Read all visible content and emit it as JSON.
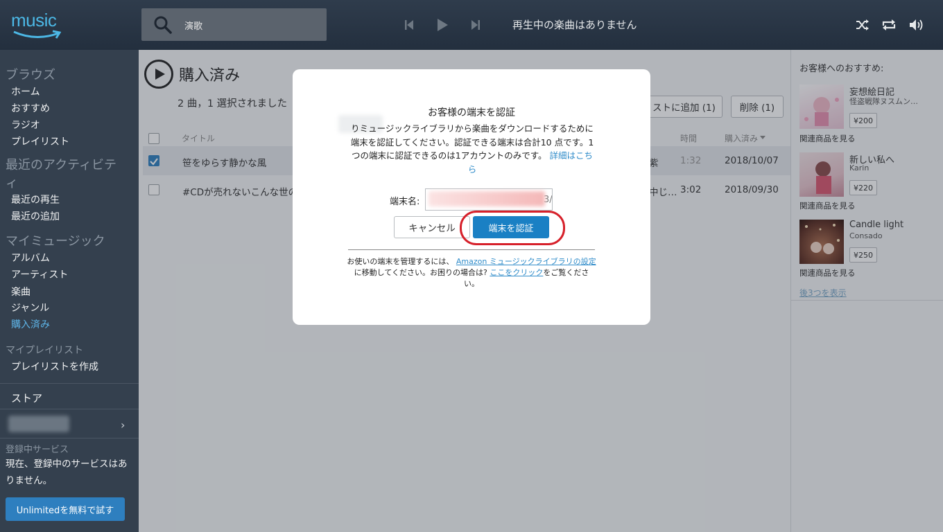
{
  "app": {
    "logo_text": "music",
    "brand_color": "#4cb8e6"
  },
  "search": {
    "value": "演歌"
  },
  "player": {
    "now_playing": "再生中の楽曲はありません"
  },
  "sidebar": {
    "browse_head": "ブラウズ",
    "browse_items": [
      "ホーム",
      "おすすめ",
      "ラジオ",
      "プレイリスト"
    ],
    "recent_head": "最近のアクティビティ",
    "recent_items": [
      "最近の再生",
      "最近の追加"
    ],
    "mymusic_head": "マイミュージック",
    "mymusic_items": [
      "アルバム",
      "アーティスト",
      "楽曲",
      "ジャンル",
      "購入済み"
    ],
    "playlists_head": "マイプレイリスト",
    "create_playlist": "プレイリストを作成",
    "store": "ストア",
    "services_head": "登録中サービス",
    "services_text": "現在、登録中のサービスはありません。",
    "unlimited_button": "Unlimitedを無料で試す"
  },
  "main": {
    "title": "購入済み",
    "selection": "2 曲，1 選択されました",
    "add_button": "ストに追加 (1)",
    "delete_button": "削除 (1)",
    "columns": {
      "title": "タイトル",
      "time": "時間",
      "purchased": "購入済み"
    },
    "rows": [
      {
        "title": "笹をゆらす静かな風",
        "extra": "紫",
        "time": "1:32",
        "date": "2018/10/07",
        "checked": true
      },
      {
        "title": "#CDが売れないこんな世の",
        "extra": "中じ…",
        "time": "3:02",
        "date": "2018/09/30",
        "checked": false
      }
    ]
  },
  "recommend": {
    "title": "お客様へのおすすめ:",
    "related_label": "関連商品を見る",
    "more": "後3つを表示",
    "items": [
      {
        "name": "妄想絵日記",
        "artist": "怪盗戦隊ヌスムン…",
        "price": "¥200"
      },
      {
        "name": "新しい私へ",
        "artist": "Karin",
        "price": "¥220"
      },
      {
        "name": "Candle light",
        "artist": "Consado",
        "price": "¥250"
      }
    ]
  },
  "modal": {
    "title": "お客様の端末を認証",
    "body": "りミュージックライブラリから楽曲をダウンロードするために端末を認証してください。認証できる端末は合計10 点です。1つの端末に認証できるのは1アカウントのみです。",
    "details_link": "詳細はこちら",
    "device_label": "端末名:",
    "device_suffix": "3/",
    "cancel": "キャンセル",
    "authorize": "端末を認証",
    "footer_pre": "お使いの端末を管理するには、",
    "footer_link1": "Amazon ミュージックライブラリの設定",
    "footer_mid": "に移動してください。お困りの場合は? ",
    "footer_link2": "ここをクリック",
    "footer_post": "をご覧ください。"
  }
}
